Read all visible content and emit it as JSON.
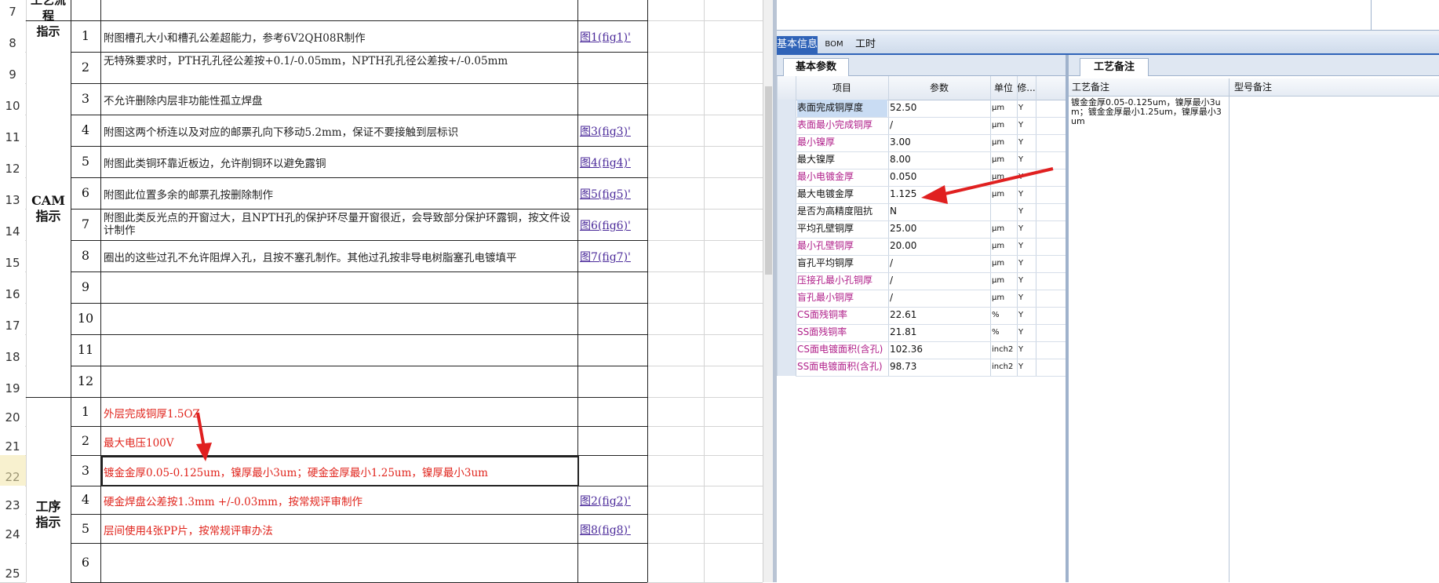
{
  "sheet": {
    "row_numbers": [
      "7",
      "8",
      "9",
      "10",
      "11",
      "12",
      "13",
      "14",
      "15",
      "16",
      "17",
      "18",
      "19",
      "20",
      "21",
      "22",
      "23",
      "24",
      "25"
    ],
    "top_group_label": "工艺流程\n指示",
    "cam_group_label": "CAM\n指示",
    "process_group_label": "工序\n指示",
    "cam_rows": [
      {
        "no": "1",
        "text": "附图槽孔大小和槽孔公差超能力，参考6V2QH08R制作",
        "link": "图1(fig1)'"
      },
      {
        "no": "2",
        "text": "无特殊要求时，PTH孔孔径公差按+0.1/-0.05mm，NPTH孔孔径公差按+/-0.05mm",
        "link": ""
      },
      {
        "no": "3",
        "text": "不允许删除内层非功能性孤立焊盘",
        "link": ""
      },
      {
        "no": "4",
        "text": "附图这两个桥连以及对应的邮票孔向下移动5.2mm，保证不要接触到层标识",
        "link": "图3(fig3)'"
      },
      {
        "no": "5",
        "text": "附图此类铜环靠近板边，允许削铜环以避免露铜",
        "link": "图4(fig4)'"
      },
      {
        "no": "6",
        "text": "附图此位置多余的邮票孔按删除制作",
        "link": "图5(fig5)'"
      },
      {
        "no": "7",
        "text": "附图此类反光点的开窗过大，且NPTH孔的保护环尽量开窗很近，会导致部分保护环露铜，按文件设计制作",
        "link": "图6(fig6)'"
      },
      {
        "no": "8",
        "text": "圈出的这些过孔不允许阻焊入孔，且按不塞孔制作。其他过孔按非导电树脂塞孔电镀填平",
        "link": "图7(fig7)'"
      },
      {
        "no": "9",
        "text": "",
        "link": ""
      },
      {
        "no": "10",
        "text": "",
        "link": ""
      },
      {
        "no": "11",
        "text": "",
        "link": ""
      },
      {
        "no": "12",
        "text": "",
        "link": ""
      }
    ],
    "process_rows": [
      {
        "no": "1",
        "text": "外层完成铜厚1.5OZ",
        "link": ""
      },
      {
        "no": "2",
        "text": "最大电压100V",
        "link": ""
      },
      {
        "no": "3",
        "text": "镀金金厚0.05-0.125um，镍厚最小3um；硬金金厚最小1.25um，镍厚最小3um",
        "link": ""
      },
      {
        "no": "4",
        "text": "硬金焊盘公差按1.3mm +/-0.03mm，按常规评审制作",
        "link": "图2(fig2)'"
      },
      {
        "no": "5",
        "text": "层间使用4张PP片，按常规评审办法",
        "link": "图8(fig8)'"
      },
      {
        "no": "6",
        "text": "",
        "link": ""
      }
    ]
  },
  "app": {
    "tabs": [
      "基本信息",
      "BOM",
      "工时"
    ],
    "left_panel_tab": "基本参数",
    "right_panel_tab": "工艺备注",
    "table_headers": [
      "项目",
      "参数",
      "单位",
      "修..."
    ],
    "params": [
      {
        "name": "表面完成铜厚度",
        "value": "52.50",
        "unit": "μm",
        "flag": "Y",
        "pink": false
      },
      {
        "name": "表面最小完成铜厚",
        "value": "/",
        "unit": "μm",
        "flag": "Y",
        "pink": true
      },
      {
        "name": "最小镍厚",
        "value": "3.00",
        "unit": "μm",
        "flag": "Y",
        "pink": true
      },
      {
        "name": "最大镍厚",
        "value": "8.00",
        "unit": "μm",
        "flag": "Y",
        "pink": false
      },
      {
        "name": "最小电镀金厚",
        "value": "0.050",
        "unit": "μm",
        "flag": "Y",
        "pink": true
      },
      {
        "name": "最大电镀金厚",
        "value": "1.125",
        "unit": "μm",
        "flag": "Y",
        "pink": false
      },
      {
        "name": "是否为高精度阻抗",
        "value": "N",
        "unit": "",
        "flag": "Y",
        "pink": false
      },
      {
        "name": "平均孔壁铜厚",
        "value": "25.00",
        "unit": "μm",
        "flag": "Y",
        "pink": false
      },
      {
        "name": "最小孔壁铜厚",
        "value": "20.00",
        "unit": "μm",
        "flag": "Y",
        "pink": true
      },
      {
        "name": "盲孔平均铜厚",
        "value": "/",
        "unit": "μm",
        "flag": "Y",
        "pink": false
      },
      {
        "name": "压接孔最小孔铜厚",
        "value": "/",
        "unit": "μm",
        "flag": "Y",
        "pink": true
      },
      {
        "name": "盲孔最小铜厚",
        "value": "/",
        "unit": "μm",
        "flag": "Y",
        "pink": true
      },
      {
        "name": "CS面残铜率",
        "value": "22.61",
        "unit": "%",
        "flag": "Y",
        "pink": true
      },
      {
        "name": "SS面残铜率",
        "value": "21.81",
        "unit": "%",
        "flag": "Y",
        "pink": true
      },
      {
        "name": "CS面电镀面积(含孔)",
        "value": "102.36",
        "unit": "inch2",
        "flag": "Y",
        "pink": true
      },
      {
        "name": "SS面电镀面积(含孔)",
        "value": "98.73",
        "unit": "inch2",
        "flag": "Y",
        "pink": true
      }
    ],
    "remarks_headers": [
      "工艺备注",
      "型号备注"
    ],
    "remarks_text": "镀金金厚0.05-0.125um，镍厚最小3um；镀金金厚最小1.25um，镍厚最小3um",
    "colors": {
      "arrow": "#e02020",
      "pink_text": "#b0208a",
      "tab_blue": "#2f63b8"
    }
  }
}
